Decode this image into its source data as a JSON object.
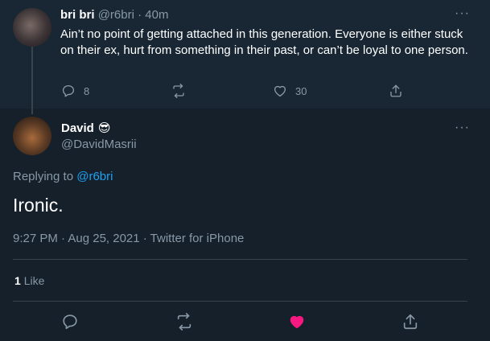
{
  "parent_tweet": {
    "display_name": "bri bri",
    "handle": "@r6bri",
    "separator": "·",
    "time": "40m",
    "text": "Ain’t no point of getting attached in this generation. Everyone is either stuck on their ex, hurt from something in their past, or can’t be loyal to one person.",
    "more": "···",
    "reply_count": "8",
    "retweet_count": "",
    "like_count": "30"
  },
  "main_tweet": {
    "display_name": "David",
    "emoji": "😎",
    "handle": "@DavidMasrii",
    "more": "···",
    "replying_prefix": "Replying to",
    "replying_to": "@r6bri",
    "text": "Ironic.",
    "meta": "9:27 PM · Aug 25, 2021 · Twitter for iPhone",
    "like_count": "1",
    "like_label": "Like"
  },
  "colors": {
    "background": "#15202b",
    "parent_background": "#192734",
    "muted": "#8899a6",
    "link": "#1da1f2",
    "liked": "#f91880",
    "divider": "#38444d"
  },
  "icons": {
    "reply": "reply-icon",
    "retweet": "retweet-icon",
    "like": "heart-outline-icon",
    "liked": "heart-filled-icon",
    "share": "share-icon"
  }
}
